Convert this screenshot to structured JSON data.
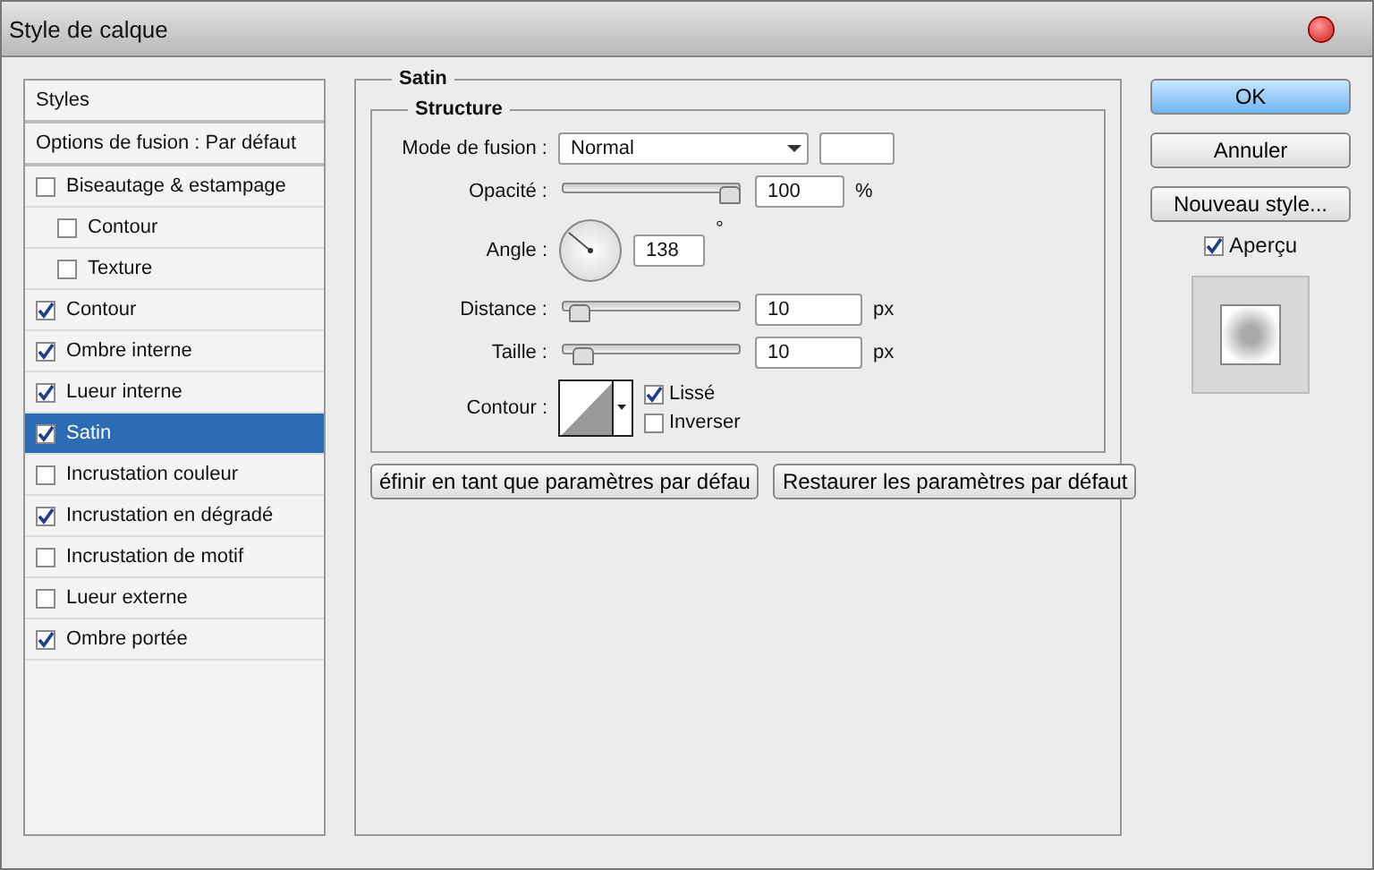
{
  "window": {
    "title": "Style de calque"
  },
  "sidebar": {
    "header": "Styles",
    "blend_options": "Options de fusion : Par défaut",
    "items": [
      {
        "label": "Biseautage & estampage",
        "checked": false,
        "selected": false,
        "children": [
          {
            "label": "Contour",
            "checked": false,
            "selected": false
          },
          {
            "label": "Texture",
            "checked": false,
            "selected": false
          }
        ]
      },
      {
        "label": "Contour",
        "checked": true,
        "selected": false
      },
      {
        "label": "Ombre interne",
        "checked": true,
        "selected": false
      },
      {
        "label": "Lueur interne",
        "checked": true,
        "selected": false
      },
      {
        "label": "Satin",
        "checked": true,
        "selected": true
      },
      {
        "label": "Incrustation couleur",
        "checked": false,
        "selected": false
      },
      {
        "label": "Incrustation en dégradé",
        "checked": true,
        "selected": false
      },
      {
        "label": "Incrustation de motif",
        "checked": false,
        "selected": false
      },
      {
        "label": "Lueur externe",
        "checked": false,
        "selected": false
      },
      {
        "label": "Ombre portée",
        "checked": true,
        "selected": false
      }
    ]
  },
  "panel": {
    "title": "Satin",
    "group": "Structure",
    "blend_mode": {
      "label": "Mode de fusion :",
      "value": "Normal"
    },
    "opacity": {
      "label": "Opacité :",
      "level": 1,
      "value": "100",
      "unit": "%"
    },
    "angle": {
      "label": "Angle :",
      "value": "138",
      "unit": "°"
    },
    "distance": {
      "label": "Distance :",
      "level": 0.05,
      "value": "10",
      "unit": "px"
    },
    "size": {
      "label": "Taille :",
      "level": 0.07,
      "value": "10",
      "unit": "px"
    },
    "contour": {
      "label": "Contour :"
    },
    "options": [
      {
        "label": "Lissé",
        "checked": true
      },
      {
        "label": "Inverser",
        "checked": false
      }
    ],
    "buttons": [
      "éfinir en tant que paramètres par défau",
      "Restaurer les paramètres par défaut"
    ]
  },
  "actions": [
    {
      "label": "OK",
      "primary": true
    },
    {
      "label": "Annuler",
      "primary": false
    },
    {
      "label": "Nouveau style...",
      "primary": false
    }
  ],
  "preview": {
    "label": "Aperçu",
    "checked": true
  }
}
